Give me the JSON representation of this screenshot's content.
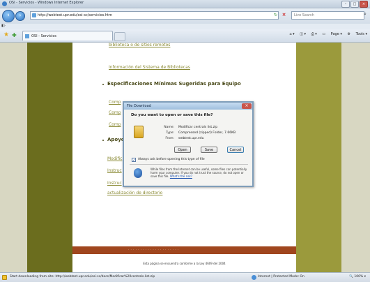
{
  "window": {
    "title": "OSI - Servicios - Windows Internet Explorer",
    "address": "http://webtest.upr.edu/osi-sc/servicios.htm",
    "search_placeholder": "Live Search",
    "tab_label": "OSI - Servicios",
    "commands": [
      "Page",
      "Tools"
    ]
  },
  "page": {
    "top_text": "biblioteca o de sitios remotos",
    "link_library": "Información del Sistema de Bibliotecas",
    "section_specs": "Especificaciones Mínimas Sugeridas para Equipo",
    "spec_links": [
      "Comp",
      "Comp",
      "Comp"
    ],
    "section_support": "Apoyo",
    "support_links": [
      "Modific",
      "Instruc",
      "Instruc"
    ],
    "support_link_last": "actualización de directorio",
    "support_link_suffix": "nload",
    "footer_text": "Esta página se encuentra conforme a la Ley 4609 del 2004"
  },
  "dialog": {
    "title": "File Download",
    "question": "Do you want to open or save this file?",
    "name_label": "Name:",
    "name_value": "Modificar centrals list.zip",
    "type_label": "Type:",
    "type_value": "Compressed (zipped) Folder, 7.66KB",
    "from_label": "From:",
    "from_value": "webtest.upr.edu",
    "open_label": "Open",
    "save_label": "Save",
    "cancel_label": "Cancel",
    "always_ask_label": "Always ask before opening this type of file",
    "warning_text": "While files from the Internet can be useful, some files can potentially harm your computer. If you do not trust the source, do not open or save this file.",
    "warning_link": "What's the risk?"
  },
  "statusbar": {
    "message": "Start downloading from site: http://webtest.upr.edu/osi-sc/docs/Modificar%20centrals.list.zip",
    "zone": "Internet | Protected Mode: On",
    "zoom": "100%"
  },
  "colors": {
    "olive_dark": "#6b6d1e",
    "olive_light": "#9b9a3c",
    "link": "#8a8a35",
    "footer_bar": "#a0461e"
  }
}
